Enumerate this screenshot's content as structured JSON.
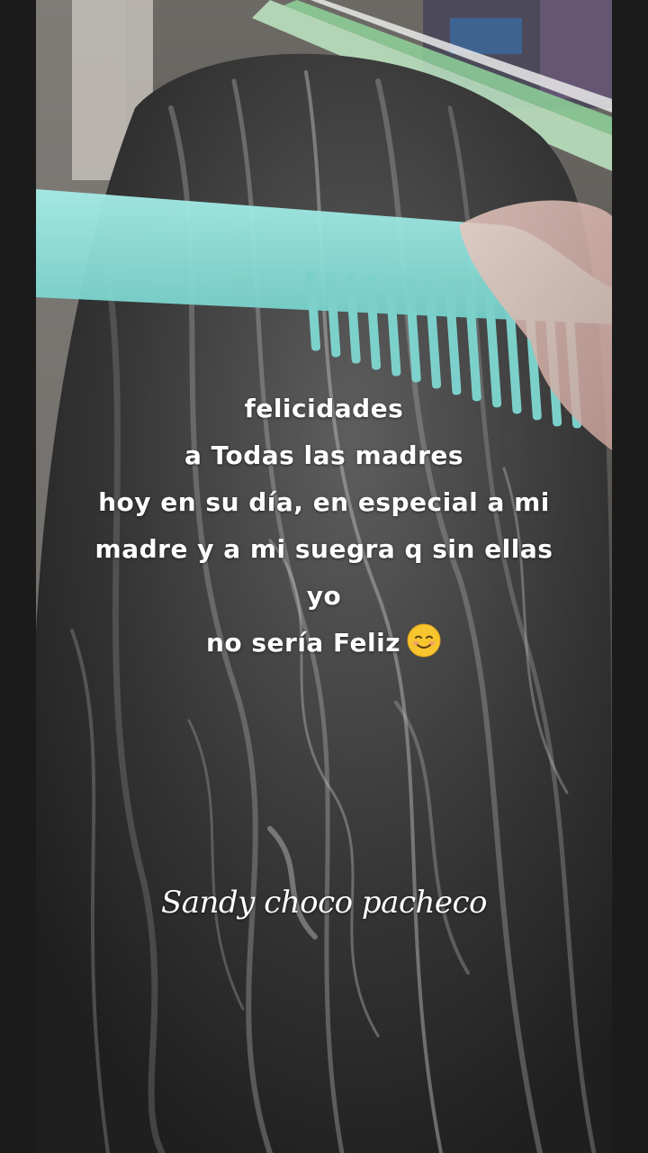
{
  "caption": {
    "lines": [
      "felicidades",
      "a Todas las madres",
      "hoy en su día, en especial a mi",
      "madre y a mi suegra q sin ellas",
      "yo",
      "no sería Feliz"
    ],
    "emoji": "smiling-face-icon"
  },
  "signature": "Sandy choco pacheco",
  "colors": {
    "comb": "#8fe3de",
    "hair_dark": "#2a2a2a",
    "hair_gray": "#9a9a9a",
    "letterbox": "#1b1b1b",
    "hammock_green": "#8fd39a"
  }
}
